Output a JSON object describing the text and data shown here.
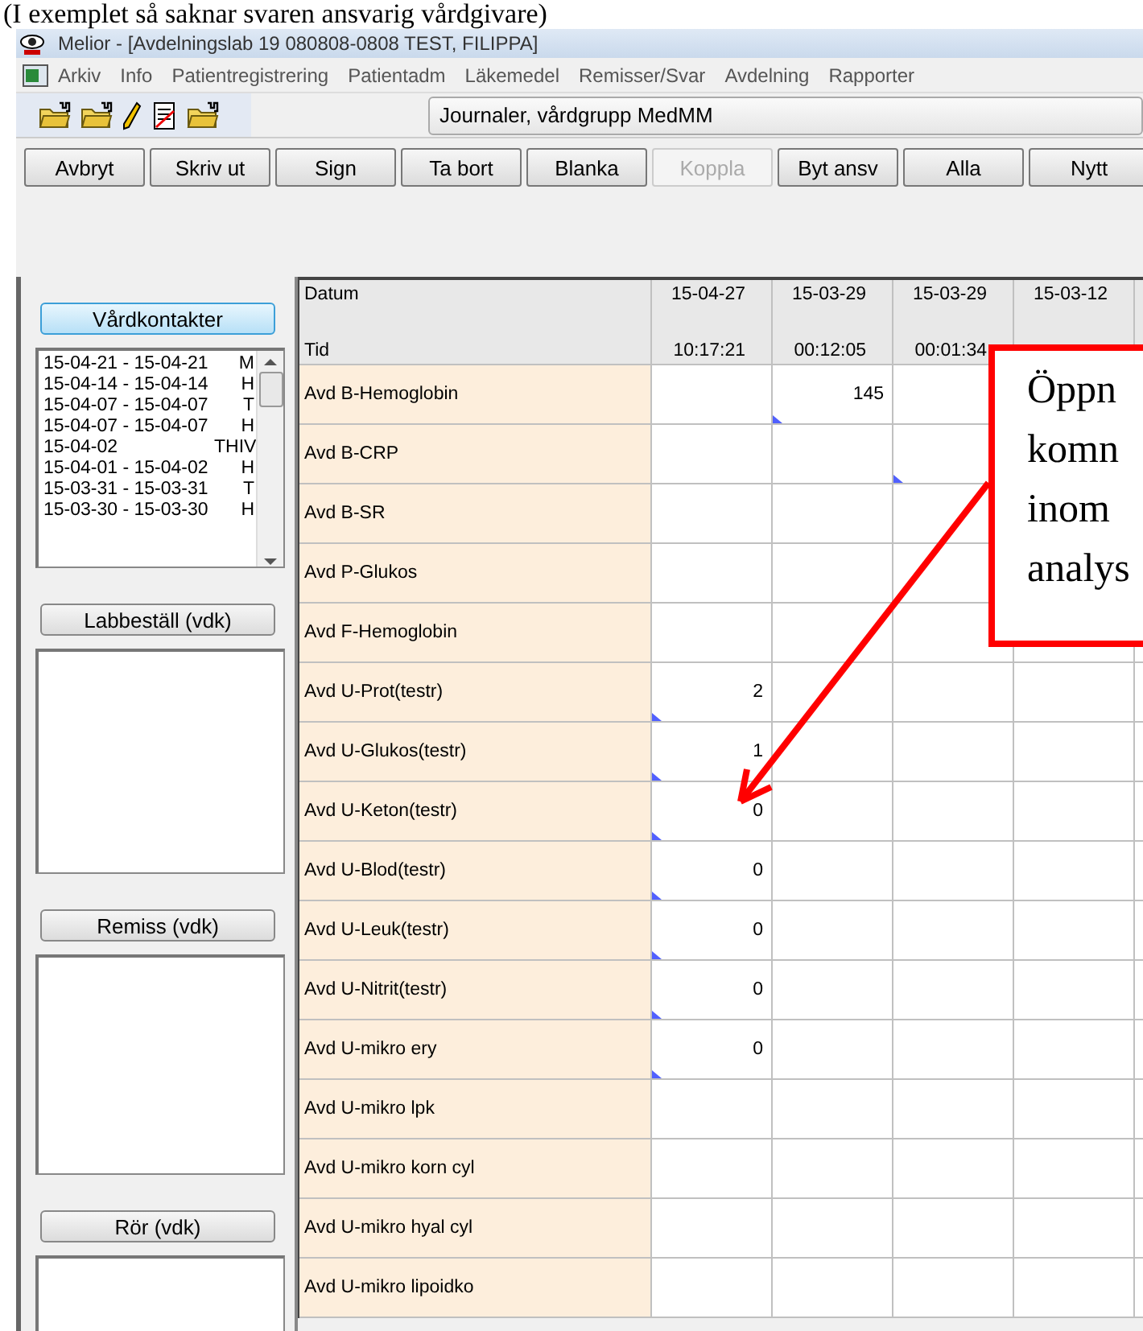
{
  "caption": "(I exemplet så saknar svaren ansvarig vårdgivare)",
  "window": {
    "title": "Melior - [Avdelningslab 19 080808-0808 TEST, FILIPPA]"
  },
  "menu": [
    "Arkiv",
    "Info",
    "Patientregistrering",
    "Patientadm",
    "Läkemedel",
    "Remisser/Svar",
    "Avdelning",
    "Rapporter"
  ],
  "toolbar": {
    "view_select": "Journaler, vårdgrupp MedMM"
  },
  "actions": [
    {
      "label": "Avbryt",
      "disabled": false
    },
    {
      "label": "Skriv ut",
      "disabled": false
    },
    {
      "label": "Sign",
      "disabled": false
    },
    {
      "label": "Ta bort",
      "disabled": false
    },
    {
      "label": "Blanka",
      "disabled": false
    },
    {
      "label": "Koppla",
      "disabled": true
    },
    {
      "label": "Byt ansv",
      "disabled": false
    },
    {
      "label": "Alla",
      "disabled": false
    },
    {
      "label": "Nytt",
      "disabled": false
    }
  ],
  "sidebar": {
    "sections": [
      {
        "button": "Vårdkontakter",
        "selected": true,
        "items": [
          {
            "dates": "15-04-21 - 15-04-21",
            "unit": "M"
          },
          {
            "dates": "15-04-14 - 15-04-14",
            "unit": "H"
          },
          {
            "dates": "15-04-07 - 15-04-07",
            "unit": "T"
          },
          {
            "dates": "15-04-07 - 15-04-07",
            "unit": "H"
          },
          {
            "dates": "15-04-02",
            "unit": "THIV"
          },
          {
            "dates": "15-04-01 - 15-04-02",
            "unit": "H"
          },
          {
            "dates": "15-03-31 - 15-03-31",
            "unit": "T"
          },
          {
            "dates": "15-03-30 - 15-03-30",
            "unit": "H"
          }
        ]
      },
      {
        "button": "Labbeställ (vdk)",
        "selected": false
      },
      {
        "button": "Remiss (vdk)",
        "selected": false
      },
      {
        "button": "Rör (vdk)",
        "selected": false
      }
    ]
  },
  "table": {
    "header_labels": [
      "Datum",
      "Tid"
    ],
    "columns": [
      {
        "date": "15-04-27",
        "time": "10:17:21"
      },
      {
        "date": "15-03-29",
        "time": "00:12:05"
      },
      {
        "date": "15-03-29",
        "time": "00:01:34"
      },
      {
        "date": "15-03-12"
      }
    ],
    "rows": [
      {
        "name": "Avd B-Hemoglobin",
        "cells": [
          {
            "flag": false
          },
          {
            "value": "145",
            "flag": true
          },
          {
            "flag": false
          },
          {}
        ]
      },
      {
        "name": "Avd B-CRP",
        "cells": [
          {
            "flag": false
          },
          {
            "flag": false
          },
          {
            "flag": true
          },
          {}
        ]
      },
      {
        "name": "Avd B-SR",
        "cells": [
          {
            "flag": false
          },
          {
            "flag": false
          },
          {
            "flag": false
          },
          {}
        ]
      },
      {
        "name": "Avd P-Glukos",
        "cells": [
          {
            "flag": false
          },
          {
            "flag": false
          },
          {
            "flag": false
          },
          {}
        ]
      },
      {
        "name": "Avd F-Hemoglobin",
        "cells": [
          {
            "flag": false
          },
          {
            "flag": false
          },
          {
            "flag": false
          },
          {}
        ]
      },
      {
        "name": "Avd U-Prot(testr)",
        "cells": [
          {
            "value": "2",
            "flag": true
          },
          {
            "flag": false
          },
          {
            "flag": false
          },
          {
            "flag": false
          }
        ]
      },
      {
        "name": "Avd U-Glukos(testr)",
        "cells": [
          {
            "value": "1",
            "flag": true
          },
          {
            "flag": false
          },
          {
            "flag": false
          },
          {
            "flag": false
          }
        ]
      },
      {
        "name": "Avd U-Keton(testr)",
        "cells": [
          {
            "value": "0",
            "flag": true
          },
          {
            "flag": false
          },
          {
            "flag": false
          },
          {
            "flag": false
          }
        ]
      },
      {
        "name": "Avd U-Blod(testr)",
        "cells": [
          {
            "value": "0",
            "flag": true
          },
          {
            "flag": false
          },
          {
            "flag": false
          },
          {
            "flag": false
          }
        ]
      },
      {
        "name": "Avd U-Leuk(testr)",
        "cells": [
          {
            "value": "0",
            "flag": true
          },
          {
            "flag": false
          },
          {
            "flag": false
          },
          {
            "flag": false
          }
        ]
      },
      {
        "name": "Avd U-Nitrit(testr)",
        "cells": [
          {
            "value": "0",
            "flag": true
          },
          {
            "flag": false
          },
          {
            "flag": false
          },
          {
            "flag": false
          }
        ]
      },
      {
        "name": "Avd U-mikro ery",
        "cells": [
          {
            "value": "0",
            "flag": true
          },
          {
            "flag": false
          },
          {
            "flag": false
          },
          {
            "flag": false
          }
        ]
      },
      {
        "name": "Avd U-mikro lpk",
        "cells": [
          {
            "flag": false
          },
          {
            "flag": false
          },
          {
            "flag": false
          },
          {
            "flag": false
          }
        ]
      },
      {
        "name": "Avd U-mikro korn cyl",
        "cells": [
          {
            "flag": false
          },
          {
            "flag": false
          },
          {
            "flag": false
          },
          {
            "flag": false
          }
        ]
      },
      {
        "name": "Avd U-mikro hyal cyl",
        "cells": [
          {
            "flag": false
          },
          {
            "flag": false
          },
          {
            "flag": false
          },
          {
            "flag": false
          }
        ]
      },
      {
        "name": "Avd U-mikro lipoidko",
        "cells": [
          {
            "flag": false
          },
          {
            "flag": false
          },
          {
            "flag": false
          },
          {
            "flag": false
          }
        ]
      }
    ]
  },
  "callout": {
    "lines": [
      "Öppn",
      "komn",
      "inom",
      "analys"
    ]
  }
}
